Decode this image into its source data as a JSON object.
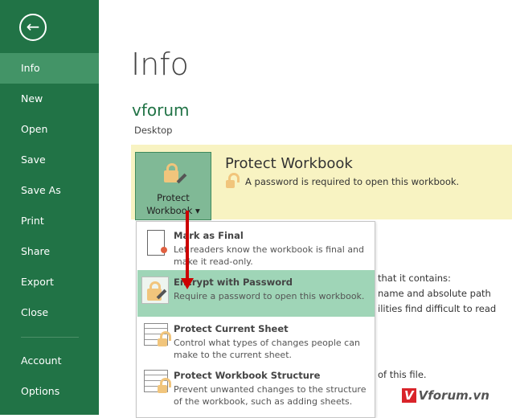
{
  "sidebar": {
    "back_label": "←",
    "items": [
      {
        "label": "Info",
        "selected": true
      },
      {
        "label": "New"
      },
      {
        "label": "Open"
      },
      {
        "label": "Save"
      },
      {
        "label": "Save As"
      },
      {
        "label": "Print"
      },
      {
        "label": "Share"
      },
      {
        "label": "Export"
      },
      {
        "label": "Close"
      },
      {
        "label": "Account"
      },
      {
        "label": "Options"
      }
    ]
  },
  "main": {
    "title": "Info",
    "workbook_name": "vforum",
    "location": "Desktop",
    "protect": {
      "button_label_1": "Protect",
      "button_label_2": "Workbook ▾",
      "title": "Protect Workbook",
      "description": "A password is required to open this workbook."
    },
    "background_text": [
      "that it contains:",
      "name and absolute path",
      "ilities find difficult to read",
      "of this file."
    ]
  },
  "menu": {
    "items": [
      {
        "title": "Mark as Final",
        "description": "Let readers know the workbook is final and make it read-only.",
        "icon": "certificate-document-icon"
      },
      {
        "title": "Encrypt with Password",
        "description": "Require a password to open this workbook.",
        "icon": "lock-key-icon",
        "highlighted": true
      },
      {
        "title": "Protect Current Sheet",
        "description": "Control what types of changes people can make to the current sheet.",
        "icon": "sheet-lock-icon"
      },
      {
        "title": "Protect Workbook Structure",
        "description": "Prevent unwanted changes to the structure of the workbook, such as adding sheets.",
        "icon": "workbook-lock-icon"
      }
    ]
  },
  "watermark": {
    "v": "V",
    "text": "Vforum.vn"
  },
  "colors": {
    "accent": "#217346",
    "highlight": "#9fd5b7",
    "band": "#f8f3c2",
    "arrow": "#cc0000"
  }
}
